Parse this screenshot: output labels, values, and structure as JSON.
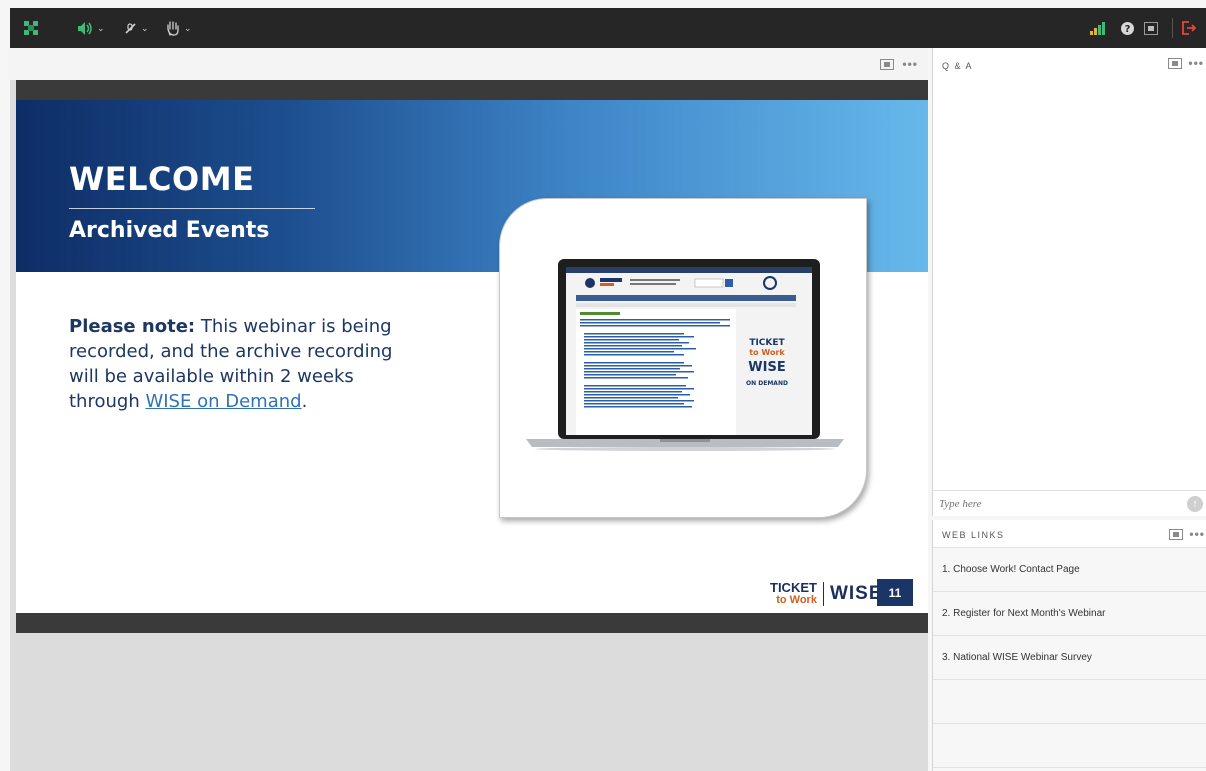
{
  "colors": {
    "topbar": "#262626",
    "accent_green": "#41b97a",
    "exit_red": "#e5453a",
    "slide_navy": "#1a3566"
  },
  "topbar": {
    "icons": [
      "layout-icon",
      "speaker-icon",
      "mic-icon",
      "raise-hand-icon",
      "connection-bars-icon",
      "help-icon",
      "fullscreen-icon",
      "exit-icon"
    ]
  },
  "slide": {
    "welcome": "WELCOME",
    "subtitle": "Archived Events",
    "note_bold": "Please note:",
    "note_text": " This webinar is being recorded, and the archive recording will be available within 2 weeks through ",
    "note_link": "WISE on Demand",
    "note_end": ".",
    "logo_ticket": "TICKET",
    "logo_to_work": "to Work",
    "logo_wise": "WISE",
    "slide_number": "11"
  },
  "qa": {
    "title": "Q & A",
    "input_placeholder": "Type here"
  },
  "web_links": {
    "title": "WEB LINKS",
    "items": [
      {
        "label": "1. Choose Work! Contact Page"
      },
      {
        "label": "2. Register for Next Month's Webinar"
      },
      {
        "label": "3. National WISE Webinar Survey"
      }
    ]
  }
}
